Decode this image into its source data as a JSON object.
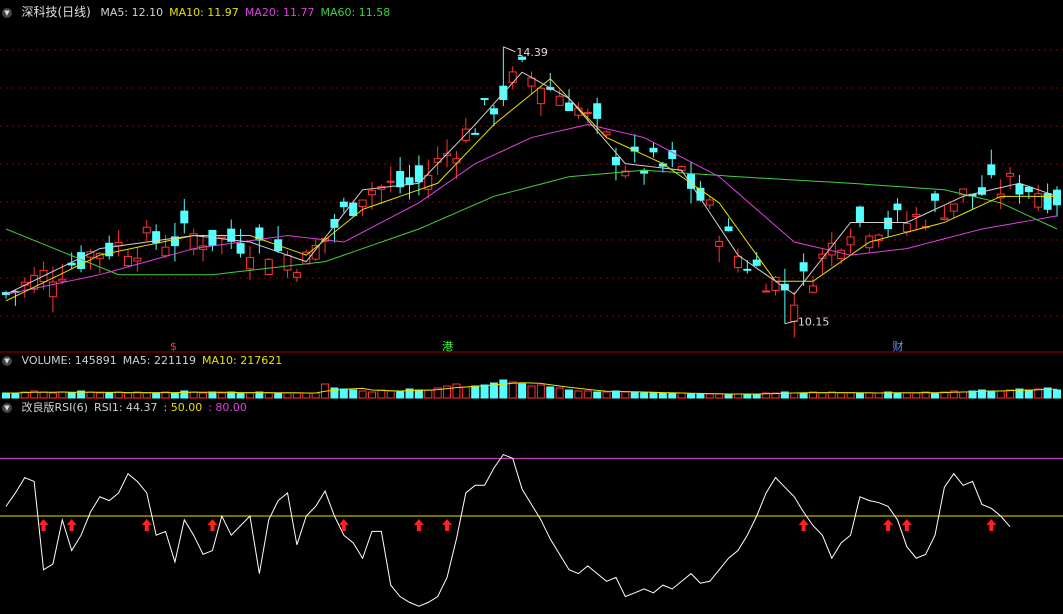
{
  "header": {
    "title": "深科技(日线)",
    "ma_labels": [
      {
        "text": "MA5: 12.10",
        "color": "#d0d0d0"
      },
      {
        "text": "MA10: 11.97",
        "color": "#e8e000"
      },
      {
        "text": "MA20: 11.77",
        "color": "#e040e0"
      },
      {
        "text": "MA60: 11.58",
        "color": "#40d040"
      }
    ]
  },
  "volume_header": {
    "labels": [
      {
        "text": "VOLUME: 145891",
        "color": "#d0d0d0"
      },
      {
        "text": "MA5: 221119",
        "color": "#d0d0d0"
      },
      {
        "text": "MA10: 217621",
        "color": "#e8e000"
      }
    ]
  },
  "rsi_header": {
    "labels": [
      {
        "text": "改良版RSI(6)",
        "color": "#d0d0d0"
      },
      {
        "text": "RSI1: 44.37",
        "color": "#d0d0d0"
      },
      {
        "text": ": 50.00",
        "color": "#e8e000"
      },
      {
        "text": ": 80.00",
        "color": "#e040e0"
      }
    ]
  },
  "colors": {
    "up": "#ff3232",
    "down": "#54ffff",
    "ma5": "#d0d0d0",
    "ma10": "#e8e000",
    "ma20": "#e040e0",
    "ma60": "#40d040",
    "grid": "#8b0000",
    "rsi": "#ffffff",
    "arrow": "#ff2020"
  },
  "chart_data": [
    {
      "type": "candlestick",
      "title": "深科技(日线)",
      "ylim": [
        9.9,
        14.8
      ],
      "annotations": [
        {
          "text": "14.39",
          "value": 14.39,
          "index": 53
        },
        {
          "text": "10.15",
          "value": 10.15,
          "index": 83
        }
      ],
      "event_markers": [
        {
          "text": "$",
          "index": 18,
          "color": "#ff3030"
        },
        {
          "text": "港",
          "index": 47,
          "color": "#30ff30"
        },
        {
          "text": "财",
          "index": 95,
          "color": "#6090ff"
        }
      ],
      "ma_anchors": {
        "ma5": [
          [
            0,
            10.6
          ],
          [
            10,
            11.3
          ],
          [
            20,
            11.5
          ],
          [
            26,
            11.4
          ],
          [
            32,
            11.1
          ],
          [
            38,
            12.2
          ],
          [
            44,
            12.3
          ],
          [
            50,
            13.2
          ],
          [
            55,
            14.0
          ],
          [
            60,
            13.6
          ],
          [
            66,
            12.6
          ],
          [
            72,
            12.5
          ],
          [
            78,
            11.2
          ],
          [
            84,
            10.6
          ],
          [
            90,
            11.7
          ],
          [
            96,
            11.7
          ],
          [
            102,
            12.1
          ],
          [
            108,
            12.3
          ],
          [
            112,
            12.1
          ]
        ],
        "ma10": [
          [
            0,
            10.5
          ],
          [
            10,
            11.2
          ],
          [
            20,
            11.5
          ],
          [
            26,
            11.5
          ],
          [
            32,
            11.2
          ],
          [
            38,
            11.9
          ],
          [
            46,
            12.3
          ],
          [
            52,
            13.2
          ],
          [
            58,
            13.9
          ],
          [
            64,
            13.0
          ],
          [
            70,
            12.6
          ],
          [
            76,
            12.0
          ],
          [
            82,
            10.8
          ],
          [
            86,
            10.8
          ],
          [
            92,
            11.4
          ],
          [
            100,
            11.7
          ],
          [
            106,
            12.1
          ],
          [
            112,
            12.1
          ]
        ],
        "ma20": [
          [
            0,
            10.6
          ],
          [
            10,
            10.9
          ],
          [
            20,
            11.3
          ],
          [
            30,
            11.5
          ],
          [
            36,
            11.4
          ],
          [
            44,
            12.0
          ],
          [
            50,
            12.6
          ],
          [
            56,
            13.0
          ],
          [
            62,
            13.2
          ],
          [
            68,
            13.0
          ],
          [
            76,
            12.4
          ],
          [
            84,
            11.4
          ],
          [
            90,
            11.2
          ],
          [
            96,
            11.3
          ],
          [
            104,
            11.6
          ],
          [
            112,
            11.8
          ]
        ],
        "ma60": [
          [
            0,
            11.6
          ],
          [
            12,
            10.9
          ],
          [
            22,
            10.9
          ],
          [
            34,
            11.1
          ],
          [
            44,
            11.6
          ],
          [
            52,
            12.1
          ],
          [
            60,
            12.4
          ],
          [
            68,
            12.5
          ],
          [
            78,
            12.4
          ],
          [
            90,
            12.3
          ],
          [
            100,
            12.2
          ],
          [
            106,
            12.0
          ],
          [
            112,
            11.6
          ]
        ]
      }
    },
    {
      "type": "bar",
      "title": "VOLUME",
      "ylim": [
        0,
        30
      ],
      "heights": [
        5,
        5,
        6,
        7,
        6,
        5,
        6,
        5,
        7,
        6,
        5,
        5,
        6,
        5,
        6,
        5,
        5,
        6,
        5,
        7,
        6,
        5,
        6,
        5,
        6,
        5,
        5,
        6,
        5,
        5,
        5,
        5,
        5,
        5,
        14,
        10,
        9,
        8,
        7,
        6,
        8,
        7,
        7,
        9,
        8,
        8,
        10,
        12,
        14,
        11,
        12,
        13,
        15,
        18,
        16,
        14,
        12,
        13,
        11,
        10,
        8,
        7,
        7,
        6,
        6,
        7,
        6,
        6,
        5,
        5,
        5,
        5,
        5,
        4,
        4,
        4,
        4,
        4,
        4,
        4,
        4,
        5,
        5,
        6,
        5,
        5,
        6,
        5,
        6,
        5,
        5,
        5,
        5,
        5,
        6,
        5,
        5,
        5,
        6,
        5,
        6,
        7,
        6,
        7,
        8,
        7,
        7,
        8,
        9,
        8,
        9,
        10,
        8
      ]
    },
    {
      "type": "line",
      "title": "改良版RSI(6)",
      "series": [
        {
          "name": "RSI1",
          "values": [
            55,
            62,
            70,
            68,
            22,
            25,
            48,
            32,
            40,
            52,
            60,
            58,
            62,
            72,
            68,
            62,
            40,
            42,
            26,
            48,
            40,
            30,
            32,
            50,
            40,
            45,
            50,
            20,
            48,
            58,
            62,
            35,
            50,
            55,
            63,
            50,
            40,
            36,
            28,
            42,
            42,
            14,
            8,
            5,
            3,
            5,
            8,
            18,
            38,
            62,
            66,
            66,
            75,
            82,
            80,
            64,
            56,
            48,
            38,
            30,
            22,
            20,
            24,
            20,
            16,
            18,
            8,
            10,
            12,
            10,
            14,
            12,
            16,
            20,
            15,
            16,
            22,
            28,
            32,
            40,
            50,
            62,
            70,
            65,
            60,
            52,
            45,
            40,
            28,
            36,
            40,
            60,
            58,
            57,
            55,
            48,
            34,
            28,
            30,
            40,
            65,
            72,
            66,
            68,
            56,
            54,
            50,
            44.37
          ]
        }
      ],
      "reference_lines": [
        {
          "text": "50.00",
          "value": 50,
          "color": "#e8e000"
        },
        {
          "text": "80.00",
          "value": 80,
          "color": "#e040e0"
        }
      ],
      "buy_arrows": [
        4,
        7,
        15,
        22,
        36,
        44,
        47,
        85,
        94,
        96,
        105
      ],
      "ylim": [
        0,
        100
      ]
    }
  ]
}
